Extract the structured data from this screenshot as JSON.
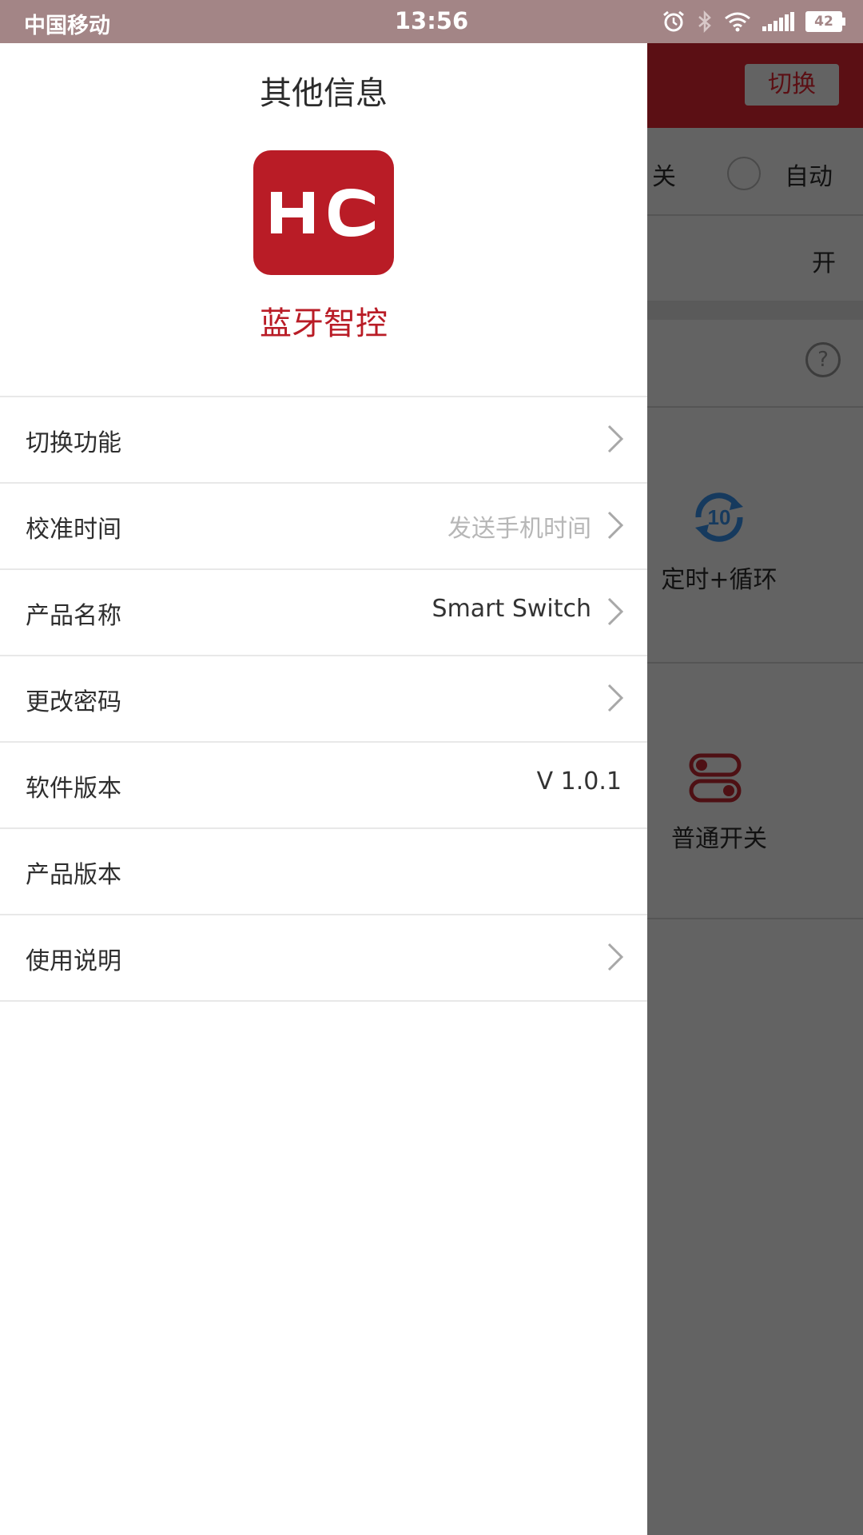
{
  "status_bar": {
    "carrier": "中国移动",
    "time": "13:56",
    "battery": "42"
  },
  "background_screen": {
    "switch_button": "切换",
    "mode_off_label": "关",
    "mode_auto_label": "自动",
    "on_label": "开",
    "tile_timer_label": "定时+循环",
    "tile_timer_icon_text": "10",
    "tile_switch_label": "普通开关"
  },
  "drawer": {
    "title": "其他信息",
    "app_name": "蓝牙智控",
    "logo_text": "HC",
    "items": [
      {
        "label": "切换功能",
        "value": "",
        "chevron": true
      },
      {
        "label": "校准时间",
        "value": "发送手机时间",
        "chevron": true
      },
      {
        "label": "产品名称",
        "value": "Smart Switch",
        "chevron": true
      },
      {
        "label": "更改密码",
        "value": "",
        "chevron": true
      },
      {
        "label": "软件版本",
        "value": "V 1.0.1",
        "chevron": false
      },
      {
        "label": "产品版本",
        "value": "",
        "chevron": false
      },
      {
        "label": "使用说明",
        "value": "",
        "chevron": true
      }
    ]
  },
  "colors": {
    "brand_red": "#b91c26",
    "status_bar": "#a38586",
    "scrim_gray": "#636363"
  }
}
